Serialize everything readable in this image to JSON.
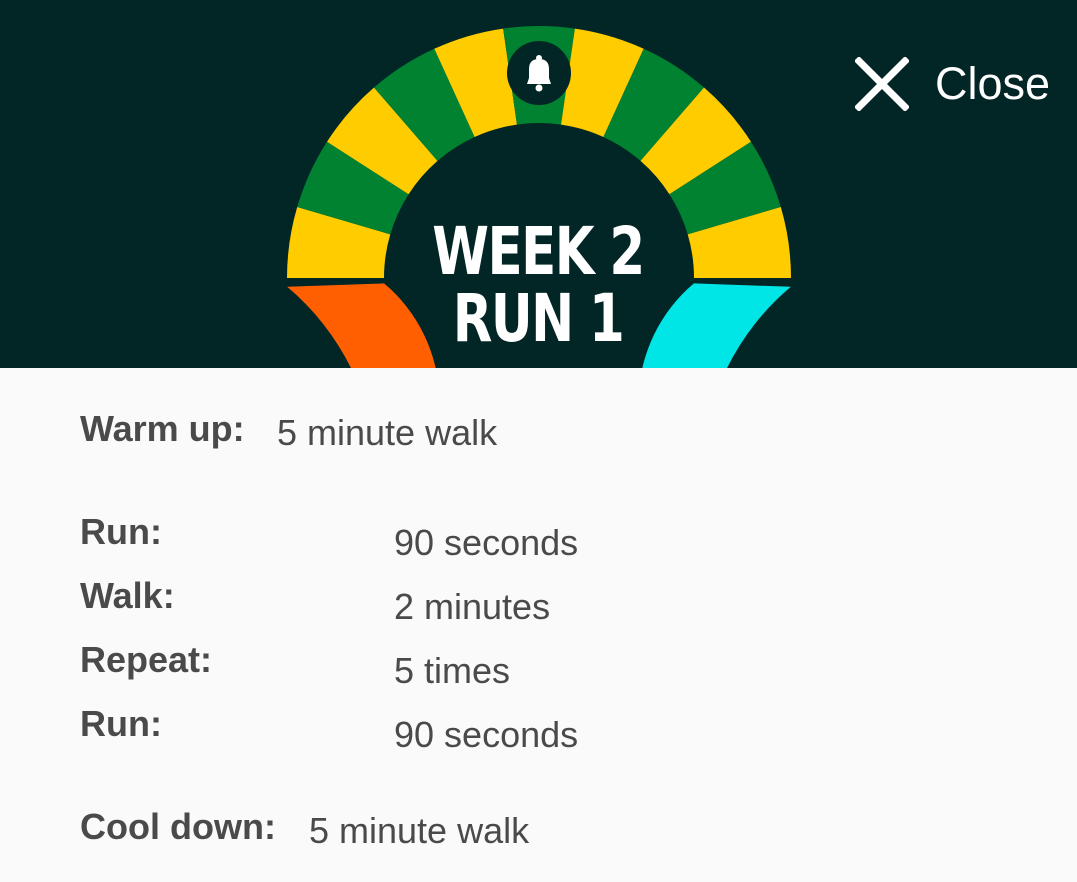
{
  "header": {
    "title_line1": "WEEK 2",
    "title_line2": "RUN 1",
    "close_label": "Close",
    "background": "#022625",
    "icons": {
      "close": "close-icon",
      "bell": "bell-icon"
    }
  },
  "ring": {
    "colors": {
      "warmup": "#ff5f00",
      "run": "#ffcc00",
      "walk": "#008230",
      "cooldown": "#00e5e5",
      "bell_bg": "#022625"
    },
    "segments": [
      "run",
      "walk",
      "run",
      "walk",
      "run",
      "walk",
      "run",
      "walk",
      "run",
      "walk",
      "run"
    ]
  },
  "plan": {
    "warmup": {
      "label": "Warm up:",
      "value": "5 minute walk"
    },
    "steps": [
      {
        "label": "Run:",
        "value": "90 seconds"
      },
      {
        "label": "Walk:",
        "value": "2 minutes"
      },
      {
        "label": "Repeat:",
        "value": "5 times"
      },
      {
        "label": "Run:",
        "value": "90 seconds"
      }
    ],
    "cooldown": {
      "label": "Cool down:",
      "value": "5 minute walk"
    }
  }
}
